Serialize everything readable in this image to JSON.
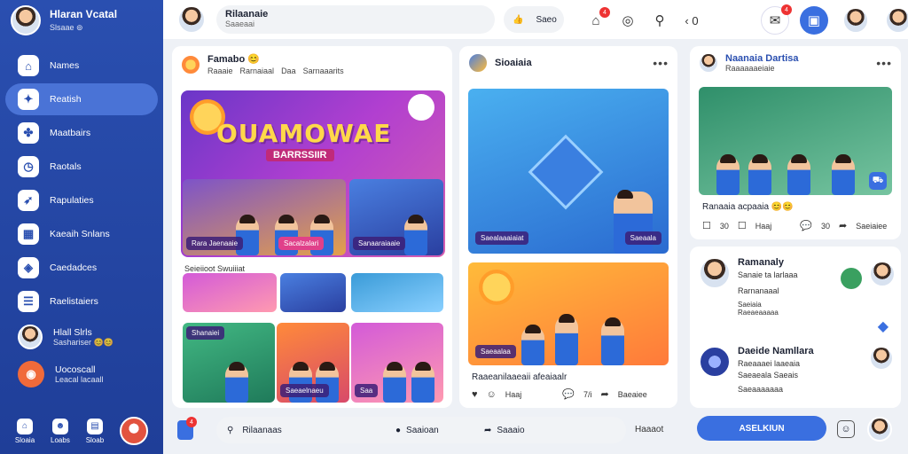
{
  "sidebar": {
    "profile": {
      "name": "Hlaran Vcatal",
      "sub": "Slsaae ⊚"
    },
    "items": [
      {
        "label": "Names",
        "icon": "home-icon",
        "glyph": "⌂"
      },
      {
        "label": "Reatish",
        "icon": "game-icon",
        "glyph": "✦",
        "active": true
      },
      {
        "label": "Maatbairs",
        "icon": "puzzle-icon",
        "glyph": "✤"
      },
      {
        "label": "Raotals",
        "icon": "clock-icon",
        "glyph": "◷"
      },
      {
        "label": "Rapulaties",
        "icon": "rocket-icon",
        "glyph": "➶"
      },
      {
        "label": "Kaeaih Snlans",
        "icon": "calendar-icon",
        "glyph": "▦"
      },
      {
        "label": "Caedadces",
        "icon": "gift-icon",
        "glyph": "◈"
      },
      {
        "label": "Raelistaiers",
        "icon": "list-icon",
        "glyph": "☰"
      },
      {
        "label": "Hlall Slrls",
        "sub": "Sashariser 😊😊",
        "icon": "user-avatar"
      },
      {
        "label": "Uocoscall",
        "sub": "Leacal lacaall",
        "icon": "chat-bubble-icon",
        "glyph": "◉"
      }
    ],
    "bottom": [
      {
        "label": "Sloaia",
        "icon": "home-small-icon",
        "glyph": "⌂"
      },
      {
        "label": "Loabs",
        "icon": "people-icon",
        "glyph": "☻"
      },
      {
        "label": "Sloab",
        "icon": "bookmark-icon",
        "glyph": "▤"
      }
    ]
  },
  "topbar": {
    "search": {
      "title": "Rilaanaie",
      "sub": "Saaeaai"
    },
    "like_label": "Saeo",
    "badge_counts": [
      "4",
      "4"
    ]
  },
  "feed": {
    "post1": {
      "title": "Famabo 😊",
      "meta": [
        "Raaaie",
        "Rarnaiaal",
        "Daa",
        "Sarnaaarits"
      ],
      "hero_title": "OUAMOWAE",
      "hero_sub": "BARRSSIIR",
      "chips": [
        "Rara Jaenaaie",
        "Sacalzalari",
        "Sanaaraiaaie"
      ],
      "section_label": "Seieiioot Swuiiiat",
      "tile_chips": [
        "Shanaiei",
        "Saeaelnaeu",
        "Saa"
      ]
    },
    "post2": {
      "title": "Sioaiaia",
      "chips": [
        "Saealaaaiaiat",
        "Saeaala",
        "Saeaalaa"
      ],
      "caption": "Raaeanilaaeaii afeaiaalr",
      "actions": [
        "Haaj",
        "7/i",
        "Baeaiee"
      ]
    }
  },
  "right": {
    "post": {
      "title": "Naanaia Dartisa",
      "sub": "Raaaaaaeiaie",
      "caption": "Ranaaia acpaaia 😊😊",
      "actions": [
        "Haaj",
        "30",
        "Saeiaiee"
      ]
    },
    "people": [
      {
        "name": "Ramanaly",
        "l1": "Sanaie ta larlaaa",
        "l2": "Rarnanaaal",
        "l3": "Saeiaia\nRaeaeaaaaa"
      },
      {
        "name": "Daeide Namllara",
        "l1": "Raeaaaei laaeaia",
        "l2": "Saeaeala Saeais",
        "l3": "Saeaaaaaaa"
      }
    ]
  },
  "bottom": {
    "search_placeholder": "Rilaanaas",
    "mid_label": "Saaioan",
    "right_label": "Saaaio",
    "home_label": "Haaaot",
    "ask_label": "ASELKIUN"
  }
}
